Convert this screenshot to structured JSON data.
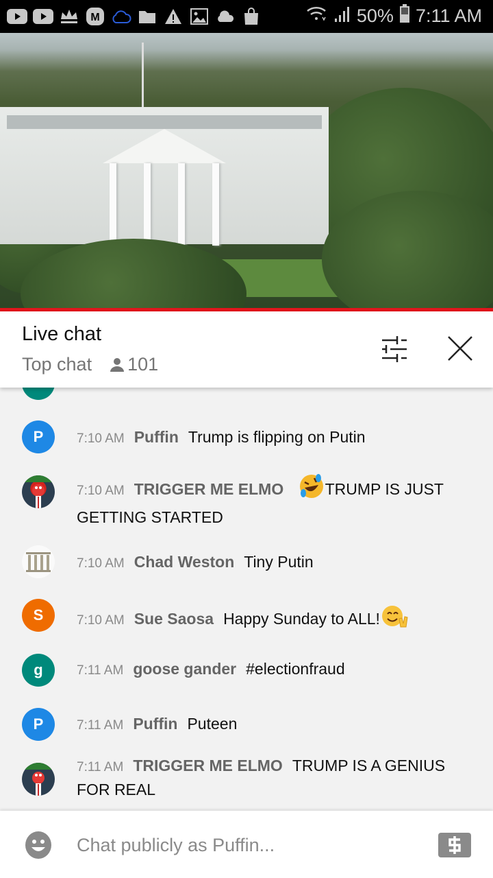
{
  "status_bar": {
    "notification_icons": [
      "youtube-icon",
      "youtube-icon",
      "crown-icon",
      "m-app-icon",
      "cloud-outline-icon",
      "folder-icon",
      "warning-icon",
      "image-icon",
      "cloud-icon",
      "shopping-bag-icon"
    ],
    "battery": "50%",
    "time": "7:11 AM"
  },
  "video": {
    "description": "White House live stream",
    "progress_color": "#e1141b"
  },
  "chat_header": {
    "title": "Live chat",
    "mode": "Top chat",
    "viewer_count": "101"
  },
  "messages": [
    {
      "time": "7:10 AM",
      "author": "Puffin",
      "text": "Trump is flipping on Putin",
      "avatar_letter": "P",
      "avatar_color": "#1e88e5",
      "emoji": null
    },
    {
      "time": "7:10 AM",
      "author": "TRIGGER ME ELMO",
      "text": "TRUMP IS JUST GETTING STARTED",
      "avatar_letter": "",
      "avatar_color": "#3a3a3a",
      "emoji": "rolling-on-floor-laughing"
    },
    {
      "time": "7:10 AM",
      "author": "Chad Weston",
      "text": "Tiny Putin",
      "avatar_letter": "",
      "avatar_color": "#ffffff",
      "emoji": null
    },
    {
      "time": "7:10 AM",
      "author": "Sue Saosa",
      "text": "Happy Sunday to ALL!",
      "avatar_letter": "S",
      "avatar_color": "#ef6c00",
      "emoji": "smiling-face-victory-hand"
    },
    {
      "time": "7:11 AM",
      "author": "goose gander",
      "text": "#electionfraud",
      "avatar_letter": "g",
      "avatar_color": "#00897b",
      "emoji": null
    },
    {
      "time": "7:11 AM",
      "author": "Puffin",
      "text": "Puteen",
      "avatar_letter": "P",
      "avatar_color": "#1e88e5",
      "emoji": null
    },
    {
      "time": "7:11 AM",
      "author": "TRIGGER ME ELMO",
      "text": "TRUMP IS A GENIUS FOR REAL",
      "avatar_letter": "",
      "avatar_color": "#3a3a3a",
      "emoji": null
    }
  ],
  "composer": {
    "placeholder": "Chat publicly as Puffin..."
  }
}
